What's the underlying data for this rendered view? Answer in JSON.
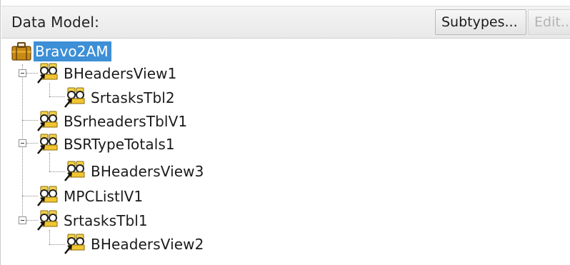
{
  "header": {
    "label": "Data Model:",
    "subtypes_button": "Subtypes...",
    "edit_button": "Edit..."
  },
  "tree": {
    "root": {
      "label": "Bravo2AM",
      "icon": "application-module-icon",
      "selected": true
    },
    "nodes": [
      {
        "label": "BHeadersView1",
        "icon": "view-object-icon",
        "expanded": true,
        "children": [
          {
            "label": "SrtasksTbl2",
            "icon": "view-object-icon"
          }
        ]
      },
      {
        "label": "BSrheadersTblV1",
        "icon": "view-object-icon"
      },
      {
        "label": "BSRTypeTotals1",
        "icon": "view-object-icon",
        "expanded": true,
        "children": [
          {
            "label": "BHeadersView3",
            "icon": "view-object-icon"
          }
        ]
      },
      {
        "label": "MPCListlV1",
        "icon": "view-object-icon"
      },
      {
        "label": "SrtasksTbl1",
        "icon": "view-object-icon",
        "expanded": true,
        "children": [
          {
            "label": "BHeadersView2",
            "icon": "view-object-icon"
          }
        ]
      }
    ]
  },
  "colors": {
    "selection": "#3d8fd6",
    "disabled_text": "#b3b3b3"
  }
}
